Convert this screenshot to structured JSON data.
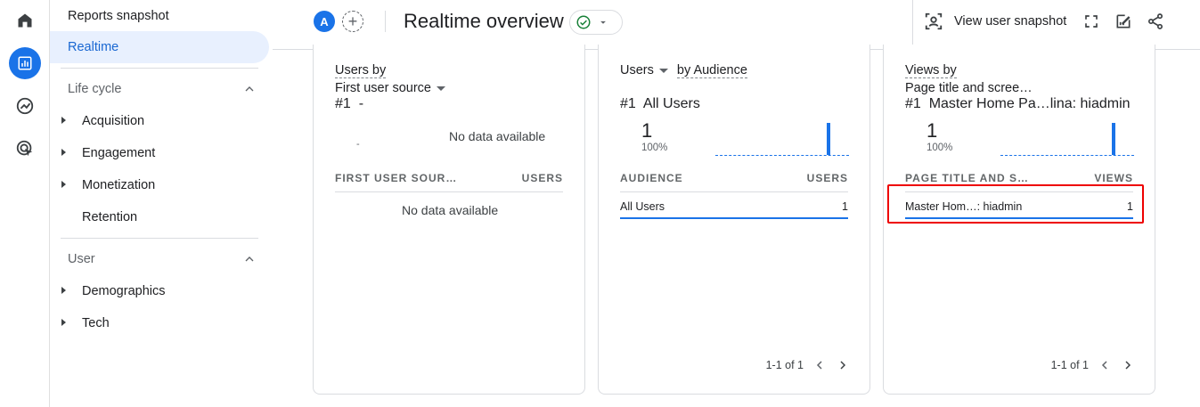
{
  "header": {
    "avatar_letter": "A",
    "add_symbol": "+",
    "page_title": "Realtime overview",
    "status_icon": "check-circle-icon",
    "view_user_snapshot_label": "View user snapshot",
    "icons": [
      "person-snapshot-icon",
      "fullscreen-icon",
      "edit-report-icon",
      "share-icon"
    ]
  },
  "rail": {
    "icons": [
      "home-icon",
      "reports-icon",
      "explore-icon",
      "advertising-icon"
    ],
    "active": "reports-icon"
  },
  "nav": {
    "reports_snapshot": "Reports snapshot",
    "realtime": "Realtime",
    "life_cycle": {
      "label": "Life cycle",
      "items": [
        "Acquisition",
        "Engagement",
        "Monetization",
        "Retention"
      ]
    },
    "user": {
      "label": "User",
      "items": [
        "Demographics",
        "Tech"
      ]
    }
  },
  "cards": [
    {
      "title_line1": "Users by",
      "title_line2": "First user source",
      "rank": "#1",
      "rank_value": "-",
      "spark_dash": "-",
      "chart_no_data": "No data available",
      "col1": "FIRST USER SOUR…",
      "col2": "USERS",
      "table_no_data": "No data available"
    },
    {
      "metric": "Users",
      "dimension": "by Audience",
      "rank": "#1",
      "rank_value": "All Users",
      "value": "1",
      "pct": "100%",
      "col1": "AUDIENCE",
      "col2": "USERS",
      "rows": [
        {
          "name": "All Users",
          "value": "1"
        }
      ],
      "pager": "1-1 of 1"
    },
    {
      "title_line1": "Views by",
      "title_line2": "Page title and scree…",
      "rank": "#1",
      "rank_value": "Master Home Pa…lina: hiadmin",
      "value": "1",
      "pct": "100%",
      "col1": "PAGE TITLE AND S…",
      "col2": "VIEWS",
      "rows": [
        {
          "name": "Master Hom…: hiadmin",
          "value": "1"
        }
      ],
      "pager": "1-1 of 1",
      "highlight_color": "#e00000"
    }
  ],
  "colors": {
    "accent": "#1a73e8",
    "active_nav_bg": "#e8f0fe",
    "highlight": "#e00000"
  }
}
